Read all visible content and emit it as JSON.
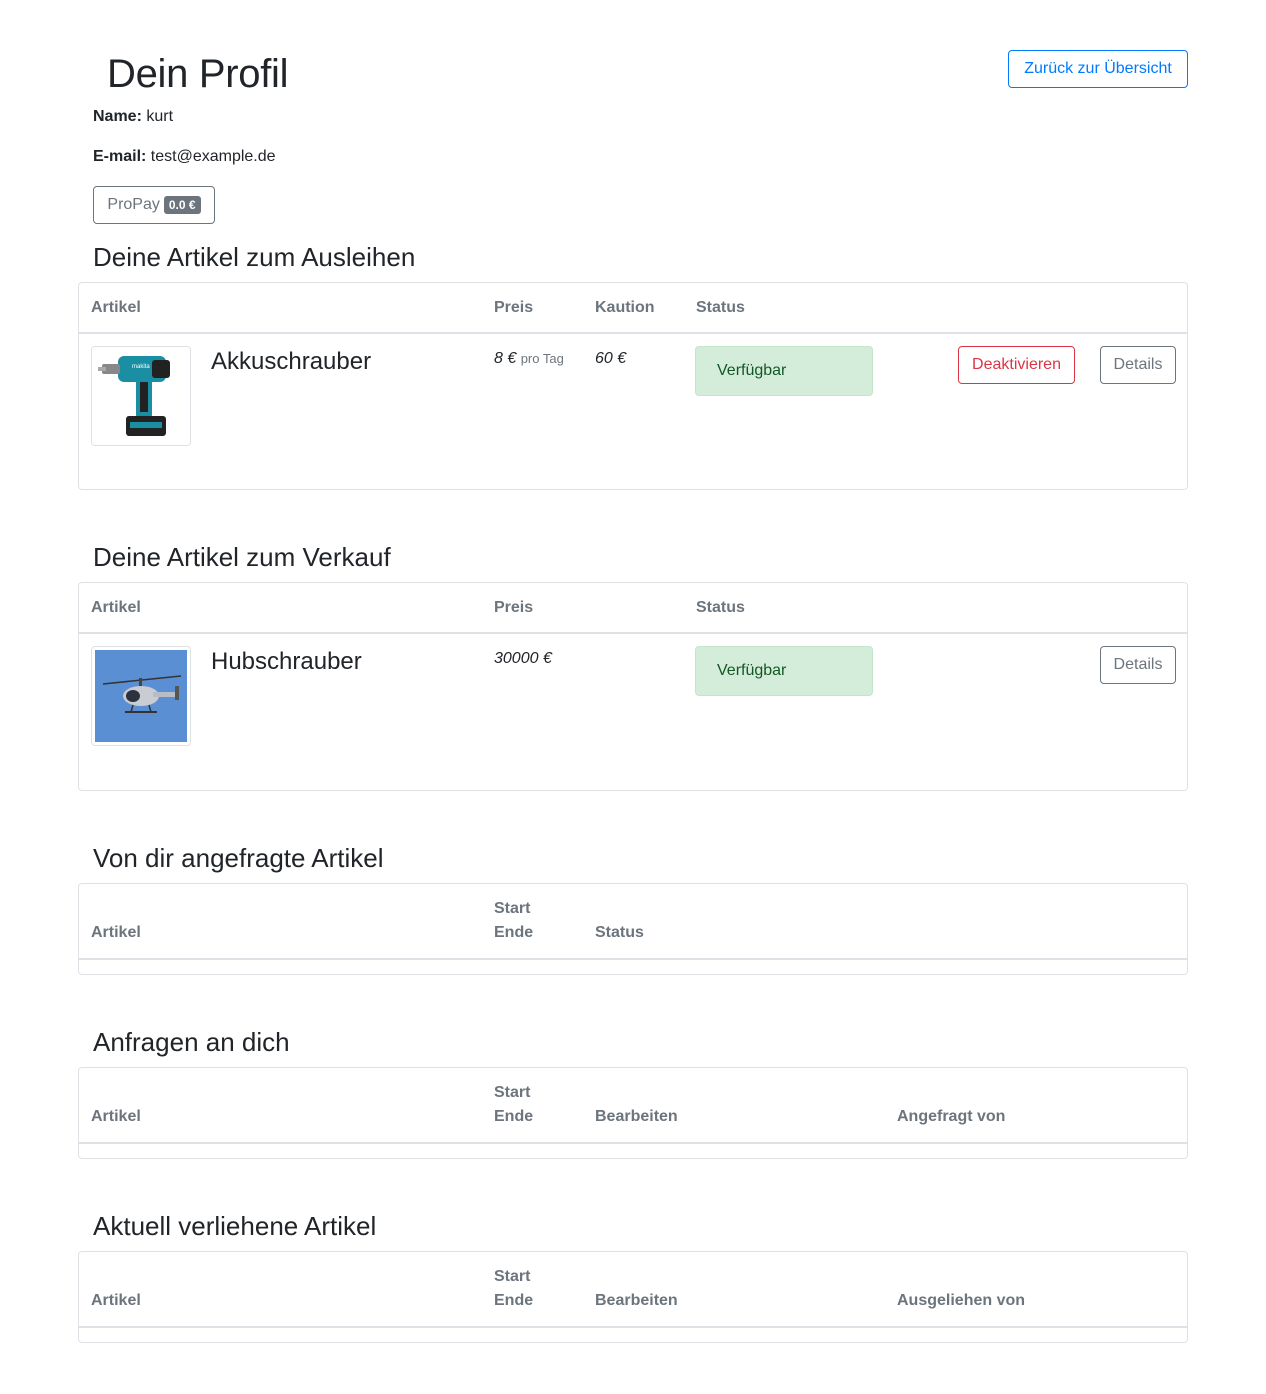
{
  "header": {
    "title": "Dein Profil",
    "back_label": "Zurück zur Übersicht"
  },
  "profile": {
    "name_label": "Name:",
    "name_value": "kurt",
    "email_label": "E-mail:",
    "email_value": "test@example.de",
    "propay_label": "ProPay",
    "propay_balance": "0.0 €"
  },
  "lend": {
    "title": "Deine Artikel zum Ausleihen",
    "columns": [
      "Artikel",
      "Preis",
      "Kaution",
      "Status"
    ],
    "items": [
      {
        "name": "Akkuschrauber",
        "price": "8 €",
        "price_unit": "pro Tag",
        "deposit": "60 €",
        "status": "Verfügbar",
        "deactivate_label": "Deaktivieren",
        "details_label": "Details",
        "image_icon": "cordless-drill-image"
      }
    ]
  },
  "sell": {
    "title": "Deine Artikel zum Verkauf",
    "columns": [
      "Artikel",
      "Preis",
      "Status"
    ],
    "items": [
      {
        "name": "Hubschrauber",
        "price": "30000 €",
        "status": "Verfügbar",
        "details_label": "Details",
        "image_icon": "helicopter-image"
      }
    ]
  },
  "requested": {
    "title": "Von dir angefragte Artikel",
    "col_article": "Artikel",
    "col_start": "Start",
    "col_end": "Ende",
    "col_status": "Status"
  },
  "requests_to_you": {
    "title": "Anfragen an dich",
    "col_article": "Artikel",
    "col_start": "Start",
    "col_end": "Ende",
    "col_edit": "Bearbeiten",
    "col_requested_by": "Angefragt von"
  },
  "lent": {
    "title": "Aktuell verliehene Artikel",
    "col_article": "Artikel",
    "col_start": "Start",
    "col_end": "Ende",
    "col_edit": "Bearbeiten",
    "col_borrowed_by": "Ausgeliehen von"
  },
  "colors": {
    "primary": "#007bff",
    "danger": "#dc3545",
    "secondary": "#6c757d",
    "success_bg": "#d4edda",
    "success_text": "#155724"
  }
}
